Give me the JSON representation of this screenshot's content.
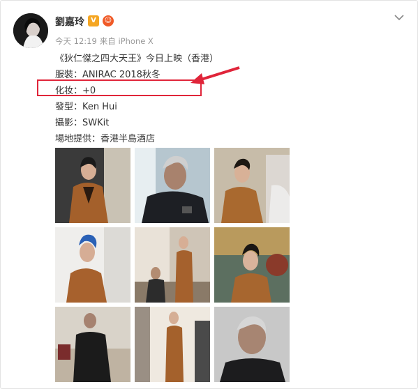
{
  "post": {
    "user": "劉嘉玲",
    "badge_v": "V",
    "time": "今天 12:19",
    "source": "来自 iPhone X",
    "lines": [
      "《狄仁傑之四大天王》今日上映（香港）",
      "服裝：ANIRAC 2018秋冬",
      "化妆：+0",
      "發型：Ken Hui",
      "攝影：SWKit",
      "場地提供：香港半島酒店"
    ]
  },
  "colors": {
    "highlight": "#e0253a",
    "text": "#333333",
    "meta": "#999999"
  },
  "photos": [
    {
      "subject": "woman-brown-suit"
    },
    {
      "subject": "man-grey-hair"
    },
    {
      "subject": "woman-brown-suit"
    },
    {
      "subject": "woman-blue-hair"
    },
    {
      "subject": "two-people-lounge"
    },
    {
      "subject": "woman-poster"
    },
    {
      "subject": "man-sofa"
    },
    {
      "subject": "woman-standing"
    },
    {
      "subject": "man-portrait"
    }
  ]
}
